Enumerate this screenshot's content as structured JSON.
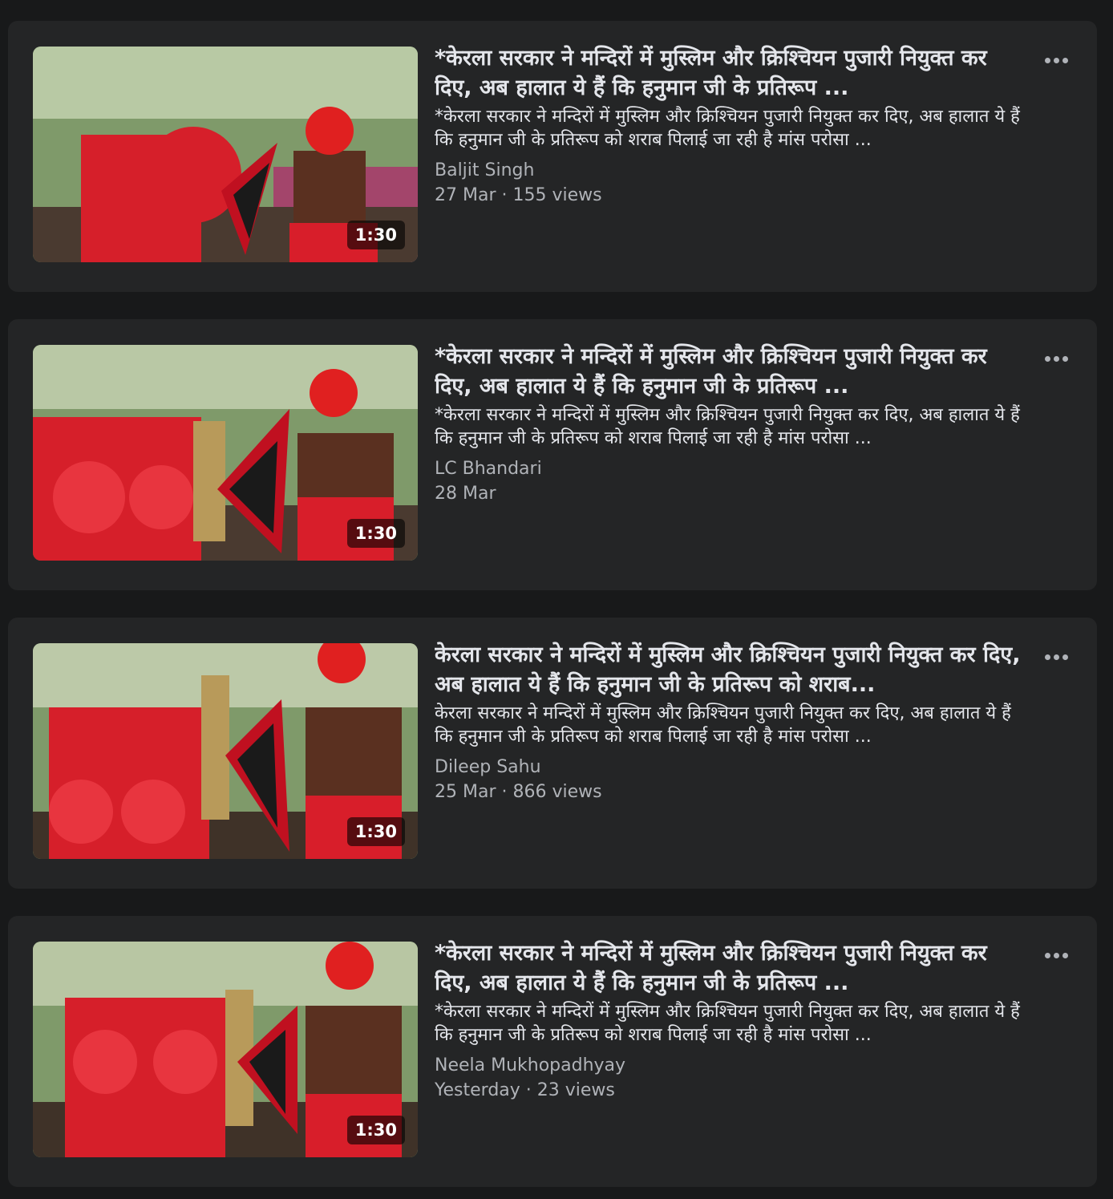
{
  "videos": [
    {
      "title": "*केरला सरकार ने मन्दिरों में मुस्लिम और क्रिश्चियन पुजारी नियुक्त कर दिए, अब हालात ये हैं कि हनुमान जी के प्रतिरूप ...",
      "description": "*केरला सरकार ने मन्दिरों में मुस्लिम और क्रिश्चियन पुजारी नियुक्त कर दिए, अब हालात ये हैं कि हनुमान जी के प्रतिरूप को शराब पिलाई जा रही है मांस परोसा ...",
      "author": "Baljit Singh",
      "meta": "27 Mar · 155 views",
      "duration": "1:30"
    },
    {
      "title": "*केरला सरकार ने मन्दिरों में मुस्लिम और क्रिश्चियन पुजारी नियुक्त कर दिए, अब हालात ये हैं कि हनुमान जी के प्रतिरूप ...",
      "description": "*केरला सरकार ने मन्दिरों में मुस्लिम और क्रिश्चियन पुजारी नियुक्त कर दिए, अब हालात ये हैं कि हनुमान जी के प्रतिरूप को शराब पिलाई जा रही है मांस परोसा ...",
      "author": "LC Bhandari",
      "meta": "28 Mar",
      "duration": "1:30"
    },
    {
      "title": "केरला सरकार ने मन्दिरों में मुस्लिम और क्रिश्चियन पुजारी नियुक्त कर दिए, अब हालात ये हैं कि हनुमान जी के प्रतिरूप को शराब...",
      "description": "केरला सरकार ने मन्दिरों में मुस्लिम और क्रिश्चियन पुजारी नियुक्त कर दिए, अब हालात ये हैं कि हनुमान जी के प्रतिरूप को शराब पिलाई जा रही है मांस परोसा ...",
      "author": "Dileep Sahu",
      "meta": "25 Mar · 866 views",
      "duration": "1:30"
    },
    {
      "title": "*केरला सरकार ने मन्दिरों में मुस्लिम और क्रिश्चियन पुजारी नियुक्त कर दिए, अब हालात ये हैं कि हनुमान जी के प्रतिरूप ...",
      "description": "*केरला सरकार ने मन्दिरों में मुस्लिम और क्रिश्चियन पुजारी नियुक्त कर दिए, अब हालात ये हैं कि हनुमान जी के प्रतिरूप को शराब पिलाई जा रही है मांस परोसा ...",
      "author": "Neela Mukhopadhyay",
      "meta": "Yesterday · 23 views",
      "duration": "1:30"
    }
  ],
  "more_icon": "more-horizontal-icon",
  "colors": {
    "page_bg": "#18191a",
    "card_bg": "#242526",
    "primary_text": "#e4e6eb",
    "secondary_text": "#b0b3b8",
    "accent_red": "#d61f2a"
  }
}
